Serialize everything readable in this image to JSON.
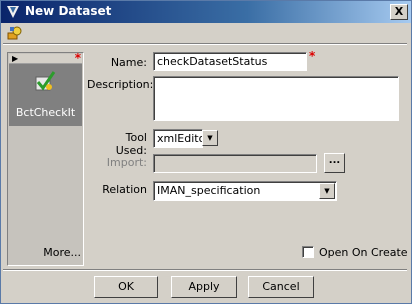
{
  "window": {
    "title": "New Dataset",
    "close_label": "X"
  },
  "type_panel": {
    "item_label": "BctCheckIt",
    "more_label": "More..."
  },
  "form": {
    "name_label": "Name:",
    "name_value": "checkDatasetStatus",
    "description_label": "Description:",
    "description_value": "",
    "tool_label": "Tool Used:",
    "tool_value": "xmlEditor",
    "import_label": "Import:",
    "import_value": "",
    "import_button": "...",
    "relation_label": "Relation",
    "relation_value": "IMAN_specification",
    "open_on_create_label": "Open On Create",
    "required_mark": "*"
  },
  "buttons": {
    "ok": "OK",
    "apply": "Apply",
    "cancel": "Cancel"
  },
  "colors": {
    "title_bg": "#0a246a",
    "required": "#dd0000",
    "face": "#d4d0c8"
  }
}
